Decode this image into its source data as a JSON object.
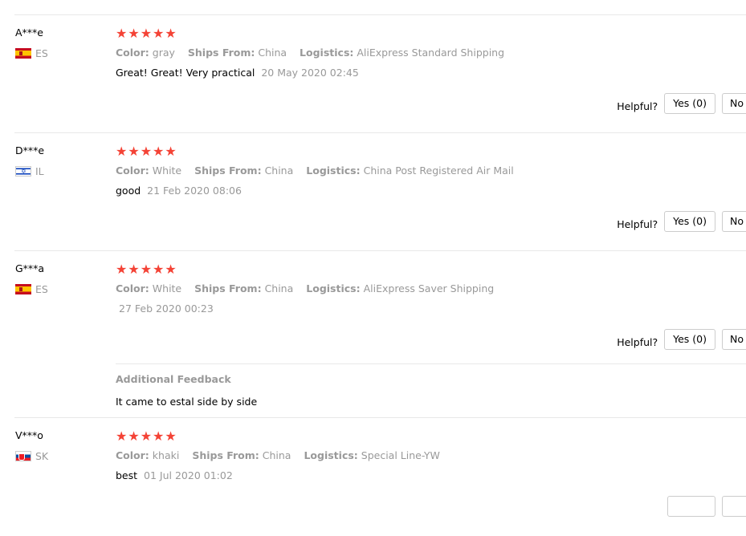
{
  "reviews": [
    {
      "user": "A***e",
      "country_code": "ES",
      "flag_icon": "spain-flag-icon",
      "rating": 5,
      "color_label": "Color:",
      "color": "gray",
      "ships_label": "Ships From:",
      "ships_from": "China",
      "logistics_label": "Logistics:",
      "logistics": "AliExpress Standard Shipping",
      "comment": "Great! Great! Very practical",
      "date": "20 May 2020 02:45",
      "helpful_label": "Helpful?",
      "yes_label": "Yes (0)",
      "no_label": "No"
    },
    {
      "user": "D***e",
      "country_code": "IL",
      "flag_icon": "israel-flag-icon",
      "rating": 5,
      "color_label": "Color:",
      "color": "White",
      "ships_label": "Ships From:",
      "ships_from": "China",
      "logistics_label": "Logistics:",
      "logistics": "China Post Registered Air Mail",
      "comment": "good",
      "date": "21 Feb 2020 08:06",
      "helpful_label": "Helpful?",
      "yes_label": "Yes (0)",
      "no_label": "No"
    },
    {
      "user": "G***a",
      "country_code": "ES",
      "flag_icon": "spain-flag-icon",
      "rating": 5,
      "color_label": "Color:",
      "color": "White",
      "ships_label": "Ships From:",
      "ships_from": "China",
      "logistics_label": "Logistics:",
      "logistics": "AliExpress Saver Shipping",
      "comment": "",
      "date": "27 Feb 2020 00:23",
      "helpful_label": "Helpful?",
      "yes_label": "Yes (0)",
      "no_label": "No",
      "additional_title": "Additional Feedback",
      "additional_text": "It came to estal side by side"
    },
    {
      "user": "V***o",
      "country_code": "SK",
      "flag_icon": "slovakia-flag-icon",
      "rating": 5,
      "color_label": "Color:",
      "color": "khaki",
      "ships_label": "Ships From:",
      "ships_from": "China",
      "logistics_label": "Logistics:",
      "logistics": "Special Line-YW",
      "comment": "best",
      "date": "01 Jul 2020 01:02"
    }
  ],
  "colors": {
    "star": "#f44336",
    "muted_text": "#999999",
    "divider": "#e8e8e8"
  }
}
